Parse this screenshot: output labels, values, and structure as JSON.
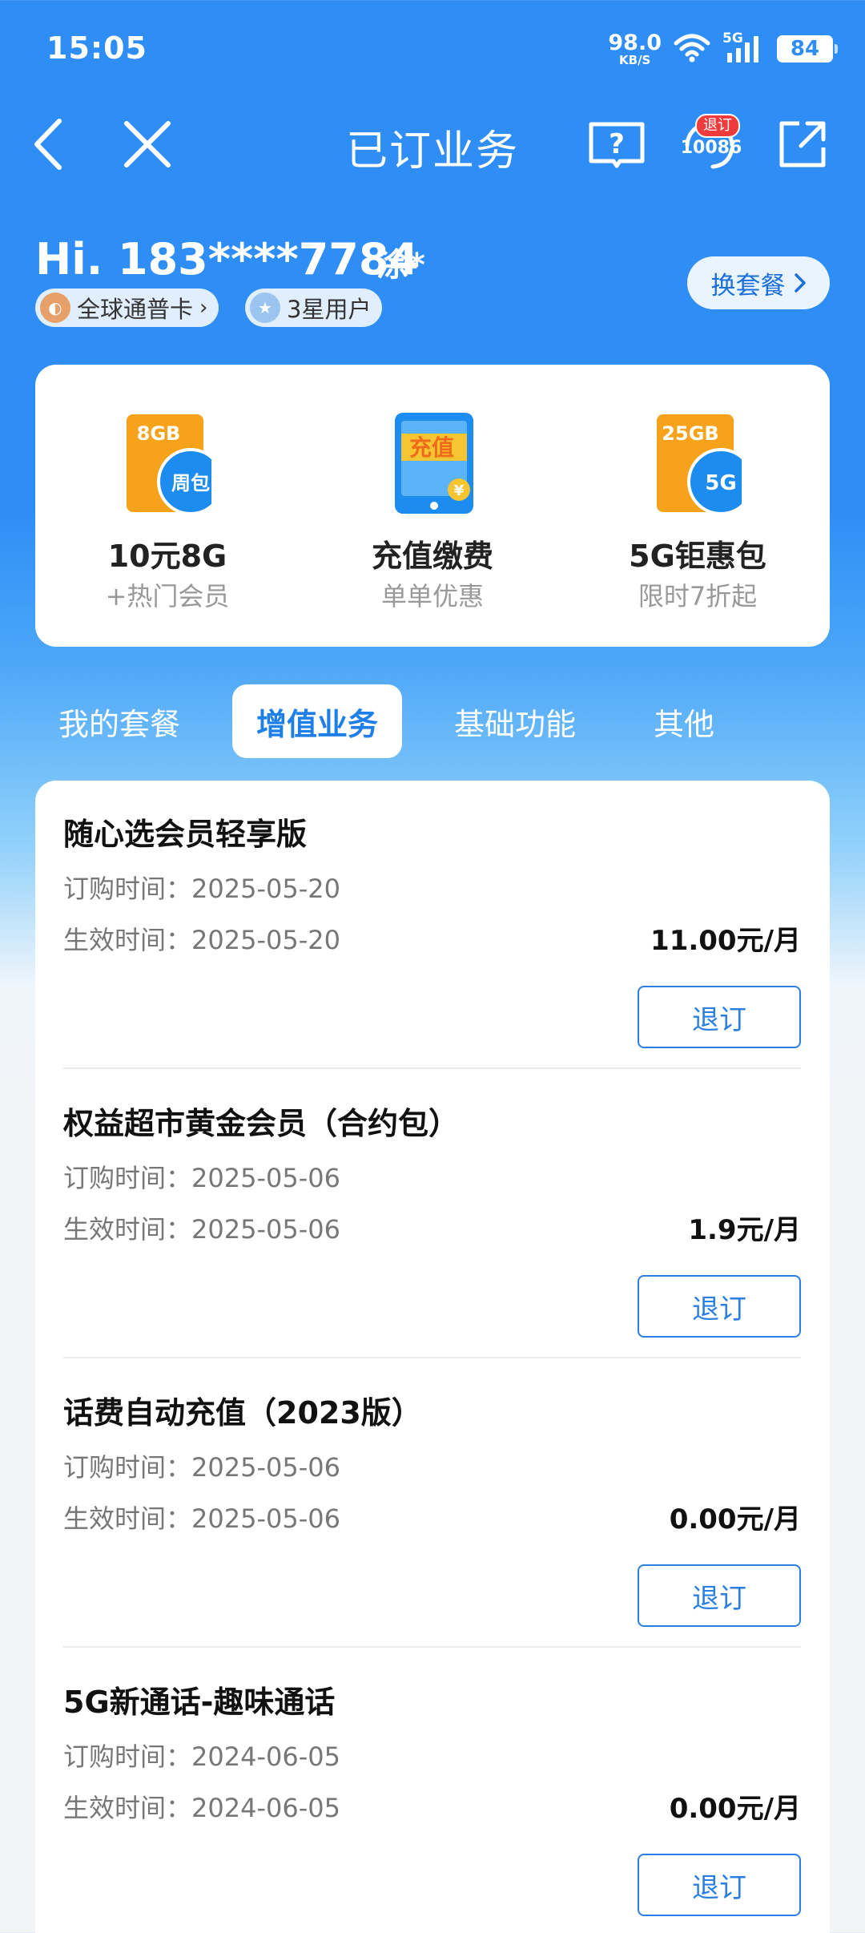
{
  "status_bar": {
    "time": "15:05",
    "net_speed_value": "98.0",
    "net_speed_unit": "KB/S",
    "network_type": "5G",
    "battery": "84"
  },
  "nav": {
    "title": "已订业务",
    "unsubscribe_badge": "退订",
    "hotline": "10086"
  },
  "user": {
    "greeting": "Hi. 183****7784",
    "name": "涂*",
    "card_tag": "全球通普卡",
    "level_tag": "3星用户",
    "switch_plan_label": "换套餐"
  },
  "quick_entries": [
    {
      "title": "10元8G",
      "subtitle": "+热门会员",
      "icon": "data-pack-8gb-icon",
      "badge_top": "8GB",
      "badge_circle": "周包"
    },
    {
      "title": "充值缴费",
      "subtitle": "单单优惠",
      "icon": "recharge-phone-icon",
      "badge_top": "充值",
      "badge_circle": "¥"
    },
    {
      "title": "5G钜惠包",
      "subtitle": "限时7折起",
      "icon": "data-pack-25gb-icon",
      "badge_top": "25GB",
      "badge_circle": "5G"
    }
  ],
  "tabs": [
    {
      "label": "我的套餐",
      "active": false
    },
    {
      "label": "增值业务",
      "active": true
    },
    {
      "label": "基础功能",
      "active": false
    },
    {
      "label": "其他",
      "active": false
    }
  ],
  "services": [
    {
      "name": "随心选会员轻享版",
      "order_label": "订购时间：",
      "order_date": "2025-05-20",
      "effective_label": "生效时间：",
      "effective_date": "2025-05-20",
      "price": "11.00元/月",
      "action": "退订"
    },
    {
      "name": "权益超市黄金会员（合约包）",
      "order_label": "订购时间：",
      "order_date": "2025-05-06",
      "effective_label": "生效时间：",
      "effective_date": "2025-05-06",
      "price": "1.9元/月",
      "action": "退订"
    },
    {
      "name": "话费自动充值（2023版）",
      "order_label": "订购时间：",
      "order_date": "2025-05-06",
      "effective_label": "生效时间：",
      "effective_date": "2025-05-06",
      "price": "0.00元/月",
      "action": "退订"
    },
    {
      "name": "5G新通话-趣味通话",
      "order_label": "订购时间：",
      "order_date": "2024-06-05",
      "effective_label": "生效时间：",
      "effective_date": "2024-06-05",
      "price": "0.00元/月",
      "action": "退订"
    }
  ],
  "colors": {
    "brand_blue": "#2f8ef6",
    "action_blue": "#2b7fe0",
    "badge_red": "#ef3b3b",
    "card_orange": "#f7a21b"
  }
}
